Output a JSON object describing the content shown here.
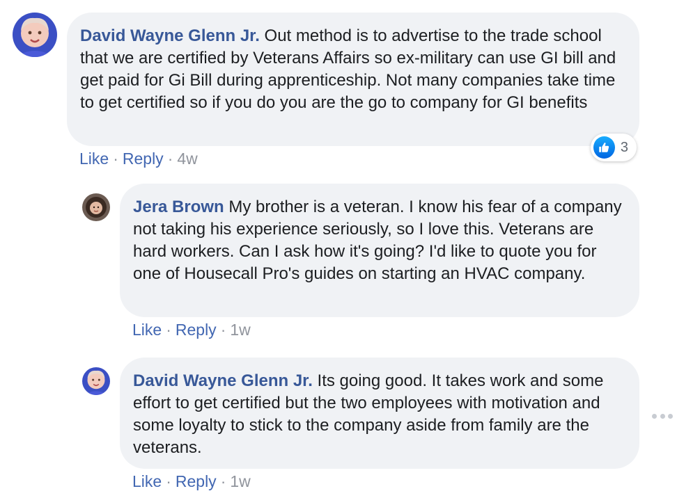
{
  "comments": [
    {
      "author": "David Wayne Glenn Jr.",
      "text": " Out method is to advertise to the trade school that we are certified by Veterans Affairs so ex-military can use GI bill and get paid for Gi Bill during apprenticeship. Not many companies take time to get certified so if you do you are the go to company for GI benefits",
      "like_label": "Like",
      "reply_label": "Reply",
      "time": "4w",
      "reaction_count": "3"
    },
    {
      "author": "Jera Brown",
      "text": " My brother is a veteran. I know his fear of a company not taking his experience seriously, so I love this. Veterans are hard workers. Can I ask how it's going? I'd like to quote you for one of Housecall Pro's guides on starting an HVAC company.",
      "like_label": "Like",
      "reply_label": "Reply",
      "time": "1w"
    },
    {
      "author": "David Wayne Glenn Jr.",
      "text": " Its going good. It takes work and some effort to get certified but the two employees with motivation and some loyalty to stick to the company aside from family are the veterans.",
      "like_label": "Like",
      "reply_label": "Reply",
      "time": "1w"
    }
  ],
  "separator": "·",
  "colors": {
    "author_link": "#385898",
    "action_link": "#4267b2",
    "bubble_bg": "#f0f2f5",
    "meta_text": "#90949c",
    "like_blue": "#1877f2"
  },
  "icons": {
    "reaction": "like-thumbs-up-icon",
    "more": "more-options-icon"
  }
}
